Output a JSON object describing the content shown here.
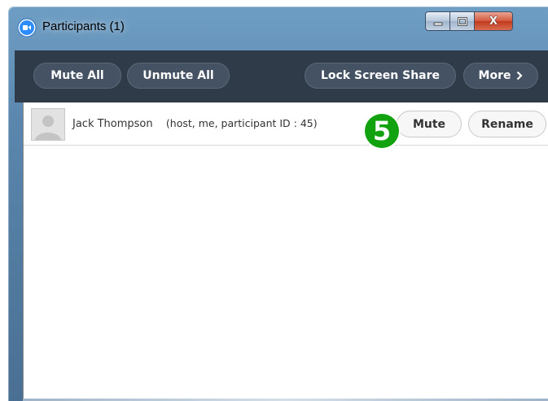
{
  "window": {
    "title": "Participants (1)",
    "icon": "zoom-app-icon",
    "controls": {
      "minimize_icon": "minimize-icon",
      "maximize_icon": "maximize-icon",
      "close_icon": "close-icon",
      "close_glyph": "X"
    }
  },
  "toolbar": {
    "mute_all": "Mute All",
    "unmute_all": "Unmute All",
    "lock_screen_share": "Lock Screen Share",
    "more": "More",
    "more_icon": "chevron-right-icon"
  },
  "participants": [
    {
      "name": "Jack Thompson",
      "details": "(host, me, participant ID : 45)",
      "avatar_icon": "user-avatar-placeholder",
      "mute_label": "Mute",
      "rename_label": "Rename"
    }
  ],
  "annotation": {
    "step_number": "5"
  },
  "colors": {
    "toolbar_bg": "#2f3b48",
    "toolbar_button_bg": "#445263",
    "step_badge": "#12a20f",
    "app_icon": "#2d8cff"
  }
}
